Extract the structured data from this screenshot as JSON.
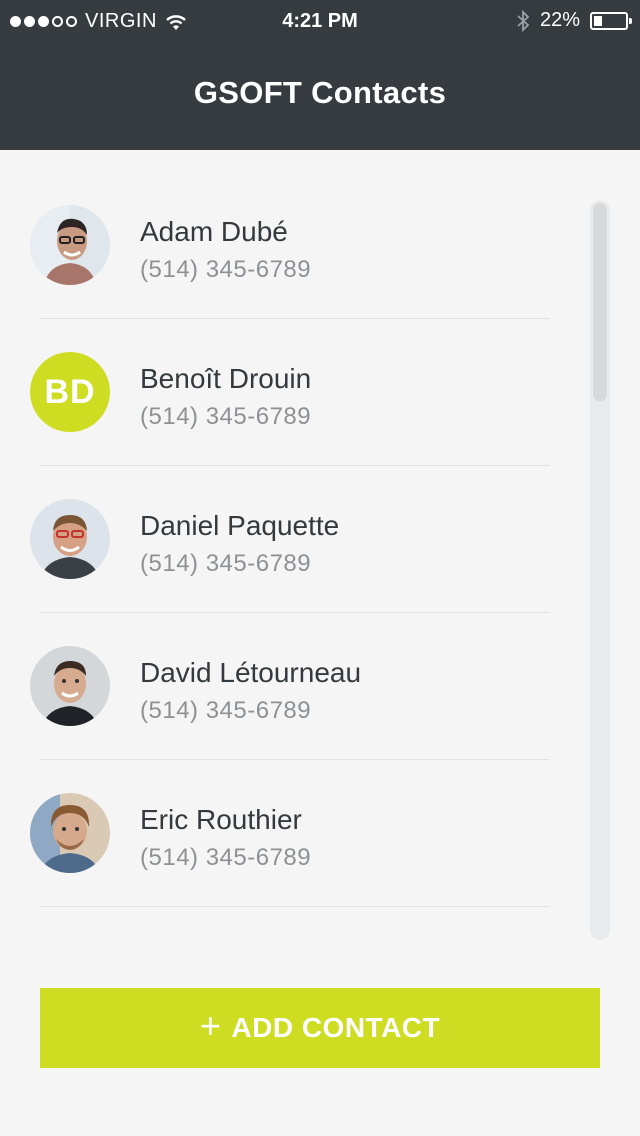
{
  "status_bar": {
    "signal_dots": 5,
    "signal_filled": 3,
    "carrier": "VIRGIN",
    "time": "4:21 PM",
    "battery": "22%",
    "battery_level": 0.22
  },
  "header": {
    "title": "GSOFT Contacts"
  },
  "contacts": [
    {
      "name": "Adam Dubé",
      "phone": "(514) 345-6789",
      "avatar": "photo"
    },
    {
      "name": "Benoît Drouin",
      "phone": "(514) 345-6789",
      "avatar": "initials",
      "initials": "BD"
    },
    {
      "name": "Daniel Paquette",
      "phone": "(514) 345-6789",
      "avatar": "photo"
    },
    {
      "name": "David Létourneau",
      "phone": "(514) 345-6789",
      "avatar": "photo"
    },
    {
      "name": "Eric Routhier",
      "phone": "(514) 345-6789",
      "avatar": "photo"
    }
  ],
  "add_button": {
    "icon": "plus-icon",
    "label": "ADD CONTACT"
  },
  "colors": {
    "header_bg": "#353b3e",
    "accent": "#cedd22",
    "background": "#f5f5f5"
  }
}
